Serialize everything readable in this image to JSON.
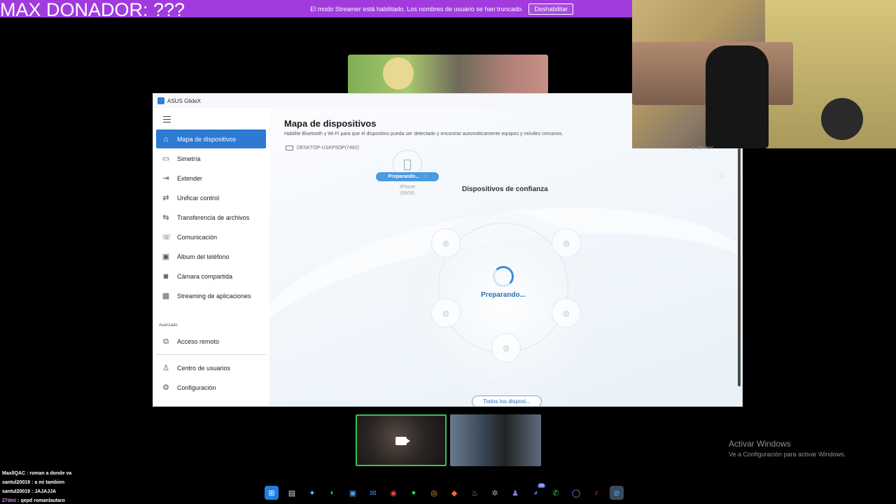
{
  "overlay": {
    "max_donador": "MAX DONADOR: ???",
    "streamer_message": "El modo Streamer está habilitado. Los nombres de usuario se han truncado.",
    "streamer_button": "Deshabilitar"
  },
  "window": {
    "title": "ASUS GlideX"
  },
  "sidebar": {
    "items": [
      {
        "label": "Mapa de dispositivos",
        "icon": "home-icon"
      },
      {
        "label": "Simetría",
        "icon": "mirror-icon"
      },
      {
        "label": "Extender",
        "icon": "extend-icon"
      },
      {
        "label": "Unificar control",
        "icon": "unify-control-icon"
      },
      {
        "label": "Transferencia de archivos",
        "icon": "file-transfer-icon"
      },
      {
        "label": "Comunicación",
        "icon": "phone-call-icon"
      },
      {
        "label": "Álbum del teléfono",
        "icon": "album-icon"
      },
      {
        "label": "Cámara compartida",
        "icon": "camera-icon"
      },
      {
        "label": "Streaming de aplicaciones",
        "icon": "apps-grid-icon"
      }
    ],
    "section_advanced": "Avanzado",
    "advanced_items": [
      {
        "label": "Acceso remoto",
        "icon": "remote-access-icon"
      }
    ],
    "bottom_items": [
      {
        "label": "Centro de usuarios",
        "icon": "user-icon"
      },
      {
        "label": "Configuración",
        "icon": "gear-icon"
      }
    ]
  },
  "main": {
    "title": "Mapa de dispositivos",
    "description": "Habilite Bluetooth y Wi-Fi para que el dispositivo pueda ser detectado y encontrar automáticamente equipos y móviles cercanos.",
    "this_device": "DESKTOP-USKP5OP(7482)",
    "phone_status": "Preparando...",
    "phone_name": "iPhone",
    "phone_id": "(6609)",
    "trusted_title": "Dispositivos de confianza",
    "center_status": "Preparando...",
    "all_devices_button": "Todos los disposi...",
    "ethernet": "Ethernet"
  },
  "activate_windows": {
    "line1": "Activar Windows",
    "line2": "Ve a Configuración para activar Windows."
  },
  "chat": [
    {
      "user": "MaxllQAC",
      "message": "roman a donde va"
    },
    {
      "user": "santul20019",
      "message": "a mi tambien"
    },
    {
      "user": "santul20019",
      "message": "JAJAJJA"
    },
    {
      "user": "27dmi",
      "message": "qepd romanlautaro"
    }
  ],
  "taskbar": {
    "icons": [
      "windows-start-icon",
      "file-explorer-icon",
      "copilot-icon",
      "edge-icon",
      "store-icon",
      "mail-icon",
      "app-icon",
      "spotify-icon",
      "chrome-icon",
      "brave-icon",
      "steam-icon",
      "settings-icon",
      "teams-icon",
      "discord-icon",
      "whatsapp-icon",
      "app-circle-icon",
      "tiktok-icon",
      "glidex-icon"
    ],
    "discord_badge": "56"
  },
  "colors": {
    "accent": "#2d7ad3",
    "streamer_bar": "#a13bde",
    "tile_border": "#3cbf5c"
  }
}
